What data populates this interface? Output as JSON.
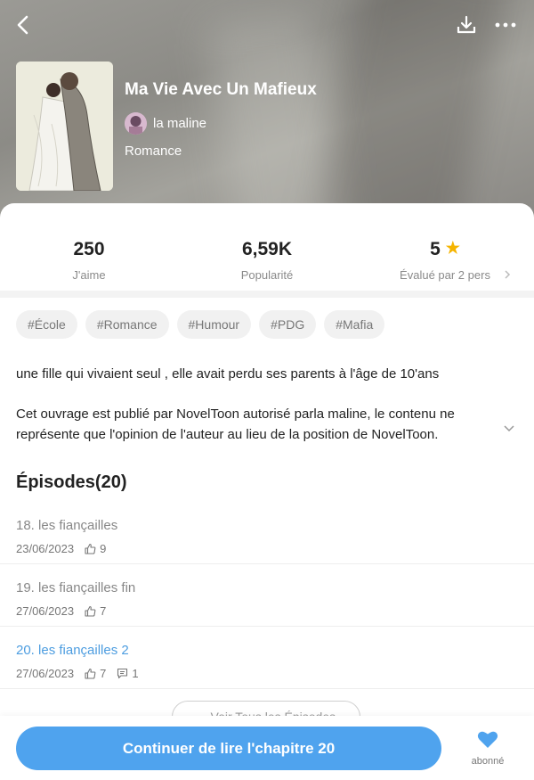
{
  "book": {
    "title": "Ma Vie Avec Un Mafieux",
    "author": "la maline",
    "genre": "Romance"
  },
  "stats": [
    {
      "value": "250",
      "label": "J'aime"
    },
    {
      "value": "6,59K",
      "label": "Popularité"
    },
    {
      "value": "5",
      "label": "Évalué par 2 pers"
    }
  ],
  "tags": [
    "#École",
    "#Romance",
    "#Humour",
    "#PDG",
    "#Mafia"
  ],
  "description": {
    "summary": "une fille qui vivaient seul , elle avait perdu ses parents à l'âge de 10'ans",
    "notice": "Cet ouvrage est publié par NovelToon  autorisé parla maline, le contenu ne représente que l'opinion de l'auteur au lieu de la position de NovelToon."
  },
  "episodes_header": "Épisodes(20)",
  "episodes": [
    {
      "title": "18. les fiançailles",
      "date": "23/06/2023",
      "likes": "9",
      "comments": "",
      "active": false
    },
    {
      "title": "19. les fiançailles fin",
      "date": "27/06/2023",
      "likes": "7",
      "comments": "",
      "active": false
    },
    {
      "title": "20. les fiançailles 2",
      "date": "27/06/2023",
      "likes": "7",
      "comments": "1",
      "active": true
    }
  ],
  "see_all": "Voir Tous les Épisodes",
  "continue_label": "Continuer de lire l'chapitre 20",
  "subscribe_label": "abonné",
  "colors": {
    "accent": "#4fa3ee",
    "star": "#f5b400",
    "active_episode": "#4d9de0"
  },
  "icons": [
    "back-arrow-icon",
    "download-icon",
    "more-icon",
    "star-icon",
    "chevron-right-icon",
    "chevron-down-icon",
    "thumb-up-icon",
    "comment-icon",
    "heart-icon"
  ]
}
